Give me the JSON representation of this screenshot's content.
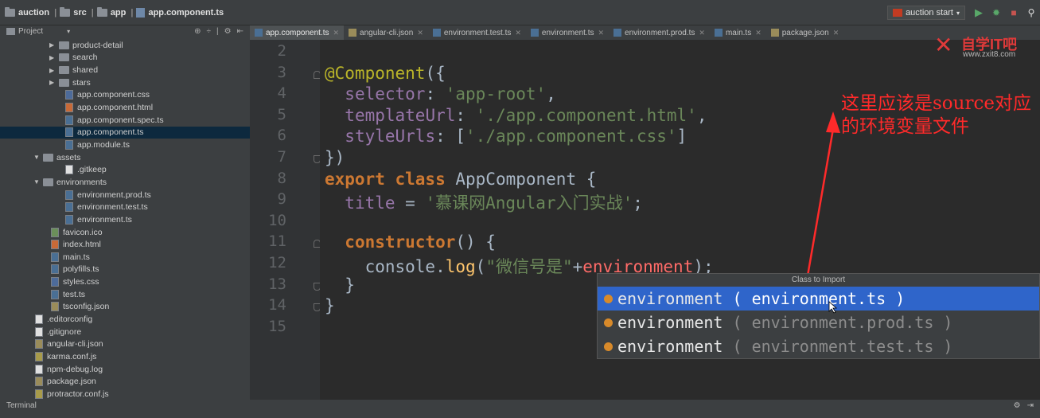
{
  "navbar": {
    "breadcrumbs": [
      "auction",
      "src",
      "app",
      "app.component.ts"
    ],
    "run_config": "auction start"
  },
  "project": {
    "title": "Project",
    "tree": [
      {
        "label": "product-detail",
        "type": "folder",
        "depth": 3,
        "expanded": false
      },
      {
        "label": "search",
        "type": "folder",
        "depth": 3,
        "expanded": false
      },
      {
        "label": "shared",
        "type": "folder",
        "depth": 3,
        "expanded": false
      },
      {
        "label": "stars",
        "type": "folder",
        "depth": 3,
        "expanded": false
      },
      {
        "label": "app.component.css",
        "type": "css",
        "depth": 4
      },
      {
        "label": "app.component.html",
        "type": "html",
        "depth": 4
      },
      {
        "label": "app.component.spec.ts",
        "type": "ts",
        "depth": 4
      },
      {
        "label": "app.component.ts",
        "type": "ts",
        "depth": 4,
        "selected": true
      },
      {
        "label": "app.module.ts",
        "type": "ts",
        "depth": 4
      },
      {
        "label": "assets",
        "type": "folder",
        "depth": 2,
        "expanded": true
      },
      {
        "label": ".gitkeep",
        "type": "txt",
        "depth": 4
      },
      {
        "label": "environments",
        "type": "folder",
        "depth": 2,
        "expanded": true
      },
      {
        "label": "environment.prod.ts",
        "type": "ts",
        "depth": 4
      },
      {
        "label": "environment.test.ts",
        "type": "ts",
        "depth": 4
      },
      {
        "label": "environment.ts",
        "type": "ts",
        "depth": 4
      },
      {
        "label": "favicon.ico",
        "type": "ico",
        "depth": 3
      },
      {
        "label": "index.html",
        "type": "html",
        "depth": 3
      },
      {
        "label": "main.ts",
        "type": "ts",
        "depth": 3
      },
      {
        "label": "polyfills.ts",
        "type": "ts",
        "depth": 3
      },
      {
        "label": "styles.css",
        "type": "css",
        "depth": 3
      },
      {
        "label": "test.ts",
        "type": "ts",
        "depth": 3
      },
      {
        "label": "tsconfig.json",
        "type": "json",
        "depth": 3
      },
      {
        "label": ".editorconfig",
        "type": "txt",
        "depth": 2
      },
      {
        "label": ".gitignore",
        "type": "txt",
        "depth": 2
      },
      {
        "label": "angular-cli.json",
        "type": "json",
        "depth": 2
      },
      {
        "label": "karma.conf.js",
        "type": "js",
        "depth": 2
      },
      {
        "label": "npm-debug.log",
        "type": "txt",
        "depth": 2
      },
      {
        "label": "package.json",
        "type": "json",
        "depth": 2
      },
      {
        "label": "protractor.conf.js",
        "type": "js",
        "depth": 2
      }
    ]
  },
  "tabs": [
    {
      "label": "app.component.ts",
      "active": true,
      "kind": "ts"
    },
    {
      "label": "angular-cli.json",
      "kind": "json"
    },
    {
      "label": "environment.test.ts",
      "kind": "ts"
    },
    {
      "label": "environment.ts",
      "kind": "ts"
    },
    {
      "label": "environment.prod.ts",
      "kind": "ts"
    },
    {
      "label": "main.ts",
      "kind": "ts"
    },
    {
      "label": "package.json",
      "kind": "json"
    }
  ],
  "editor": {
    "line_numbers": [
      "2",
      "3",
      "4",
      "5",
      "6",
      "7",
      "8",
      "9",
      "10",
      "11",
      "12",
      "13",
      "14",
      "15"
    ],
    "lines": [
      [],
      [
        {
          "t": "@Component",
          "c": "ann"
        },
        {
          "t": "({",
          "c": ""
        }
      ],
      [
        {
          "t": "  ",
          "c": ""
        },
        {
          "t": "selector",
          "c": "prop"
        },
        {
          "t": ": ",
          "c": ""
        },
        {
          "t": "'app-root'",
          "c": "str"
        },
        {
          "t": ",",
          "c": ""
        }
      ],
      [
        {
          "t": "  ",
          "c": ""
        },
        {
          "t": "templateUrl",
          "c": "prop"
        },
        {
          "t": ": ",
          "c": ""
        },
        {
          "t": "'./app.component.html'",
          "c": "str"
        },
        {
          "t": ",",
          "c": ""
        }
      ],
      [
        {
          "t": "  ",
          "c": ""
        },
        {
          "t": "styleUrls",
          "c": "prop"
        },
        {
          "t": ": [",
          "c": ""
        },
        {
          "t": "'./app.component.css'",
          "c": "str"
        },
        {
          "t": "]",
          "c": ""
        }
      ],
      [
        {
          "t": "})",
          "c": ""
        }
      ],
      [
        {
          "t": "export class ",
          "c": "kw"
        },
        {
          "t": "AppComponent {",
          "c": ""
        }
      ],
      [
        {
          "t": "  ",
          "c": ""
        },
        {
          "t": "title",
          "c": "prop"
        },
        {
          "t": " = ",
          "c": ""
        },
        {
          "t": "'慕课网Angular入门实战'",
          "c": "str"
        },
        {
          "t": ";",
          "c": ""
        }
      ],
      [],
      [
        {
          "t": "  ",
          "c": ""
        },
        {
          "t": "constructor",
          "c": "kw"
        },
        {
          "t": "() {",
          "c": ""
        }
      ],
      [
        {
          "t": "    console.",
          "c": ""
        },
        {
          "t": "log",
          "c": "fn"
        },
        {
          "t": "(",
          "c": ""
        },
        {
          "t": "\"微信号是\"",
          "c": "str"
        },
        {
          "t": "+",
          "c": ""
        },
        {
          "t": "environment",
          "c": "err"
        },
        {
          "t": ");",
          "c": ""
        }
      ],
      [
        {
          "t": "  }",
          "c": ""
        }
      ],
      [
        {
          "t": "}",
          "c": ""
        }
      ],
      []
    ]
  },
  "import_popup": {
    "title": "Class to Import",
    "options": [
      {
        "name": "environment",
        "location": "( environment.ts )",
        "selected": true
      },
      {
        "name": "environment",
        "location": "( environment.prod.ts )"
      },
      {
        "name": "environment",
        "location": "( environment.test.ts )"
      }
    ]
  },
  "annotation": {
    "text": "这里应该是source对应的环境变量文件",
    "color": "#ff2a2a"
  },
  "watermark": {
    "title": "自学IT吧",
    "url": "www.zxit8.com"
  },
  "status": {
    "label": "Terminal"
  }
}
